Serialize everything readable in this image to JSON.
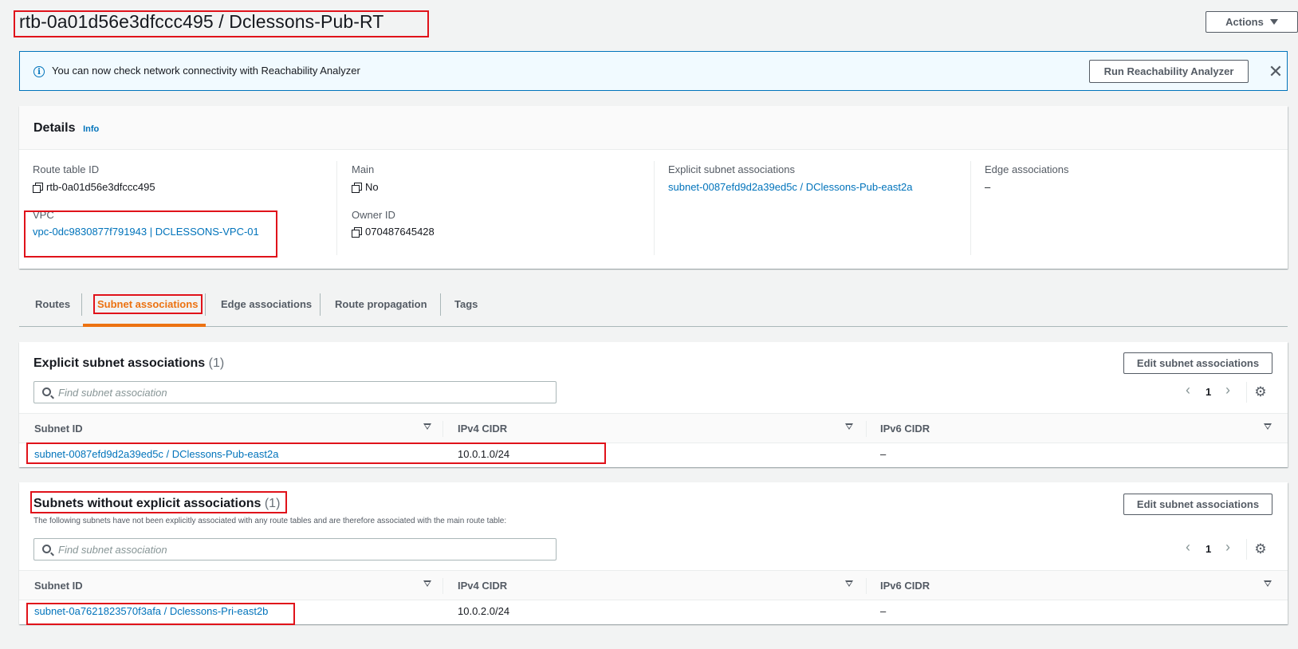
{
  "header": {
    "title": "rtb-0a01d56e3dfccc495 / Dclessons-Pub-RT",
    "actions_label": "Actions"
  },
  "flash": {
    "message": "You can now check network connectivity with Reachability Analyzer",
    "button_label": "Run Reachability Analyzer",
    "close_glyph": "✕",
    "info_glyph": "i"
  },
  "details": {
    "title": "Details",
    "info_label": "Info",
    "route_table_id_label": "Route table ID",
    "route_table_id": "rtb-0a01d56e3dfccc495",
    "vpc_label": "VPC",
    "vpc_value": "vpc-0dc9830877f791943 | DCLESSONS-VPC-01",
    "main_label": "Main",
    "main_value": "No",
    "owner_label": "Owner ID",
    "owner_value": "070487645428",
    "explicit_label": "Explicit subnet associations",
    "explicit_value": "subnet-0087efd9d2a39ed5c / DClessons-Pub-east2a",
    "edge_label": "Edge associations",
    "edge_value": "–"
  },
  "tabs": [
    {
      "label": "Routes",
      "active": false
    },
    {
      "label": "Subnet associations",
      "active": true
    },
    {
      "label": "Edge associations",
      "active": false
    },
    {
      "label": "Route propagation",
      "active": false
    },
    {
      "label": "Tags",
      "active": false
    }
  ],
  "explicit_panel": {
    "title": "Explicit subnet associations",
    "count": "(1)",
    "edit_label": "Edit subnet associations",
    "search_placeholder": "Find subnet association",
    "page": "1",
    "columns": [
      "Subnet ID",
      "IPv4 CIDR",
      "IPv6 CIDR"
    ],
    "rows": [
      {
        "subnet": "subnet-0087efd9d2a39ed5c / DClessons-Pub-east2a",
        "ipv4": "10.0.1.0/24",
        "ipv6": "–"
      }
    ]
  },
  "without_panel": {
    "title": "Subnets without explicit associations",
    "count": "(1)",
    "description": "The following subnets have not been explicitly associated with any route tables and are therefore associated with the main route table:",
    "edit_label": "Edit subnet associations",
    "search_placeholder": "Find subnet association",
    "page": "1",
    "columns": [
      "Subnet ID",
      "IPv4 CIDR",
      "IPv6 CIDR"
    ],
    "rows": [
      {
        "subnet": "subnet-0a7621823570f3afa / Dclessons-Pri-east2b",
        "ipv4": "10.0.2.0/24",
        "ipv6": "–"
      }
    ]
  },
  "icons": {
    "chevron_left": "‹",
    "chevron_right": "›",
    "gear": "⚙"
  },
  "colors": {
    "link": "#0073bb",
    "active_tab": "#ec7211",
    "annotation": "#e0121a",
    "flash_bg": "#f1faff"
  }
}
